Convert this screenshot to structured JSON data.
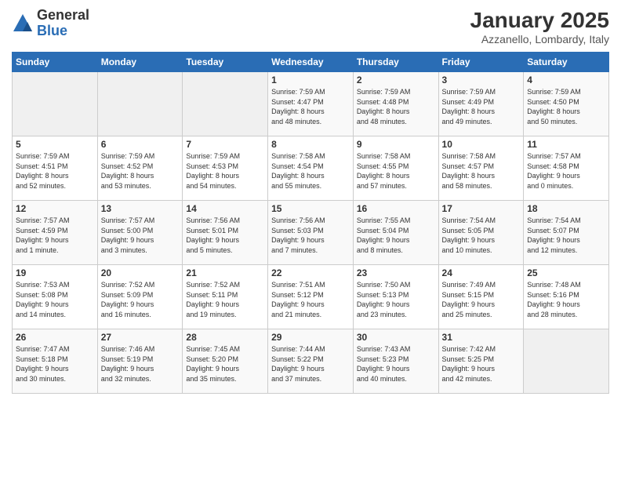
{
  "logo": {
    "general": "General",
    "blue": "Blue"
  },
  "header": {
    "title": "January 2025",
    "location": "Azzanello, Lombardy, Italy"
  },
  "days_of_week": [
    "Sunday",
    "Monday",
    "Tuesday",
    "Wednesday",
    "Thursday",
    "Friday",
    "Saturday"
  ],
  "weeks": [
    [
      {
        "day": "",
        "info": ""
      },
      {
        "day": "",
        "info": ""
      },
      {
        "day": "",
        "info": ""
      },
      {
        "day": "1",
        "info": "Sunrise: 7:59 AM\nSunset: 4:47 PM\nDaylight: 8 hours\nand 48 minutes."
      },
      {
        "day": "2",
        "info": "Sunrise: 7:59 AM\nSunset: 4:48 PM\nDaylight: 8 hours\nand 48 minutes."
      },
      {
        "day": "3",
        "info": "Sunrise: 7:59 AM\nSunset: 4:49 PM\nDaylight: 8 hours\nand 49 minutes."
      },
      {
        "day": "4",
        "info": "Sunrise: 7:59 AM\nSunset: 4:50 PM\nDaylight: 8 hours\nand 50 minutes."
      }
    ],
    [
      {
        "day": "5",
        "info": "Sunrise: 7:59 AM\nSunset: 4:51 PM\nDaylight: 8 hours\nand 52 minutes."
      },
      {
        "day": "6",
        "info": "Sunrise: 7:59 AM\nSunset: 4:52 PM\nDaylight: 8 hours\nand 53 minutes."
      },
      {
        "day": "7",
        "info": "Sunrise: 7:59 AM\nSunset: 4:53 PM\nDaylight: 8 hours\nand 54 minutes."
      },
      {
        "day": "8",
        "info": "Sunrise: 7:58 AM\nSunset: 4:54 PM\nDaylight: 8 hours\nand 55 minutes."
      },
      {
        "day": "9",
        "info": "Sunrise: 7:58 AM\nSunset: 4:55 PM\nDaylight: 8 hours\nand 57 minutes."
      },
      {
        "day": "10",
        "info": "Sunrise: 7:58 AM\nSunset: 4:57 PM\nDaylight: 8 hours\nand 58 minutes."
      },
      {
        "day": "11",
        "info": "Sunrise: 7:57 AM\nSunset: 4:58 PM\nDaylight: 9 hours\nand 0 minutes."
      }
    ],
    [
      {
        "day": "12",
        "info": "Sunrise: 7:57 AM\nSunset: 4:59 PM\nDaylight: 9 hours\nand 1 minute."
      },
      {
        "day": "13",
        "info": "Sunrise: 7:57 AM\nSunset: 5:00 PM\nDaylight: 9 hours\nand 3 minutes."
      },
      {
        "day": "14",
        "info": "Sunrise: 7:56 AM\nSunset: 5:01 PM\nDaylight: 9 hours\nand 5 minutes."
      },
      {
        "day": "15",
        "info": "Sunrise: 7:56 AM\nSunset: 5:03 PM\nDaylight: 9 hours\nand 7 minutes."
      },
      {
        "day": "16",
        "info": "Sunrise: 7:55 AM\nSunset: 5:04 PM\nDaylight: 9 hours\nand 8 minutes."
      },
      {
        "day": "17",
        "info": "Sunrise: 7:54 AM\nSunset: 5:05 PM\nDaylight: 9 hours\nand 10 minutes."
      },
      {
        "day": "18",
        "info": "Sunrise: 7:54 AM\nSunset: 5:07 PM\nDaylight: 9 hours\nand 12 minutes."
      }
    ],
    [
      {
        "day": "19",
        "info": "Sunrise: 7:53 AM\nSunset: 5:08 PM\nDaylight: 9 hours\nand 14 minutes."
      },
      {
        "day": "20",
        "info": "Sunrise: 7:52 AM\nSunset: 5:09 PM\nDaylight: 9 hours\nand 16 minutes."
      },
      {
        "day": "21",
        "info": "Sunrise: 7:52 AM\nSunset: 5:11 PM\nDaylight: 9 hours\nand 19 minutes."
      },
      {
        "day": "22",
        "info": "Sunrise: 7:51 AM\nSunset: 5:12 PM\nDaylight: 9 hours\nand 21 minutes."
      },
      {
        "day": "23",
        "info": "Sunrise: 7:50 AM\nSunset: 5:13 PM\nDaylight: 9 hours\nand 23 minutes."
      },
      {
        "day": "24",
        "info": "Sunrise: 7:49 AM\nSunset: 5:15 PM\nDaylight: 9 hours\nand 25 minutes."
      },
      {
        "day": "25",
        "info": "Sunrise: 7:48 AM\nSunset: 5:16 PM\nDaylight: 9 hours\nand 28 minutes."
      }
    ],
    [
      {
        "day": "26",
        "info": "Sunrise: 7:47 AM\nSunset: 5:18 PM\nDaylight: 9 hours\nand 30 minutes."
      },
      {
        "day": "27",
        "info": "Sunrise: 7:46 AM\nSunset: 5:19 PM\nDaylight: 9 hours\nand 32 minutes."
      },
      {
        "day": "28",
        "info": "Sunrise: 7:45 AM\nSunset: 5:20 PM\nDaylight: 9 hours\nand 35 minutes."
      },
      {
        "day": "29",
        "info": "Sunrise: 7:44 AM\nSunset: 5:22 PM\nDaylight: 9 hours\nand 37 minutes."
      },
      {
        "day": "30",
        "info": "Sunrise: 7:43 AM\nSunset: 5:23 PM\nDaylight: 9 hours\nand 40 minutes."
      },
      {
        "day": "31",
        "info": "Sunrise: 7:42 AM\nSunset: 5:25 PM\nDaylight: 9 hours\nand 42 minutes."
      },
      {
        "day": "",
        "info": ""
      }
    ]
  ]
}
